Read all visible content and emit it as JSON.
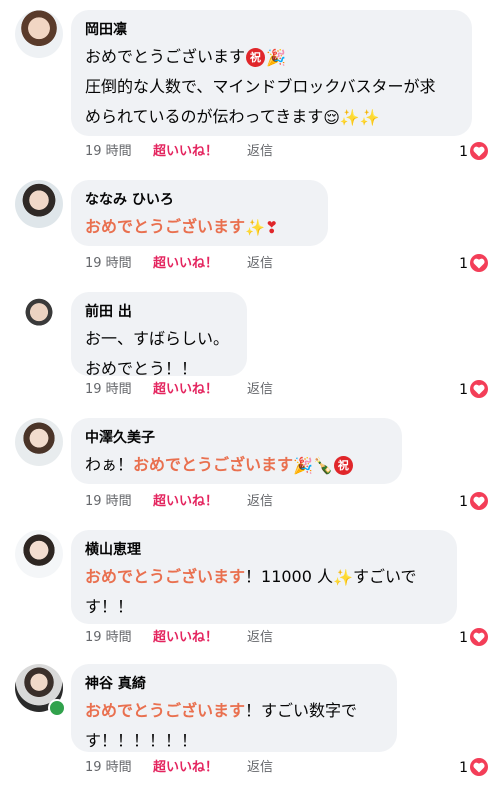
{
  "comments": [
    {
      "name": "岡田凛",
      "lines": [
        [
          {
            "t": "おめでとうございます"
          },
          {
            "badge": "祝"
          },
          {
            "e": "🎉"
          }
        ],
        [
          {
            "t": "圧倒的な人数で、マインドブロックバスターが求"
          }
        ],
        [
          {
            "t": "められているのが伝わってきます"
          },
          {
            "e": "😌✨✨"
          }
        ]
      ],
      "time": "19 時間",
      "like": "超いいね！",
      "reply": "返信",
      "reactions": "1"
    },
    {
      "name": "ななみ ひいろ",
      "lines": [
        [
          {
            "t": "おめでとうございます",
            "hl": true
          },
          {
            "e": "✨❣"
          }
        ]
      ],
      "time": "19 時間",
      "like": "超いいね！",
      "reply": "返信",
      "reactions": "1"
    },
    {
      "name": "前田 出",
      "lines": [
        [
          {
            "t": "お一、すばらしい。"
          }
        ],
        [
          {
            "t": "おめでとう！！"
          }
        ]
      ],
      "time": "19 時間",
      "like": "超いいね！",
      "reply": "返信",
      "reactions": "1"
    },
    {
      "name": "中澤久美子",
      "lines": [
        [
          {
            "t": "わぁ！"
          },
          {
            "t": "おめでとうございます",
            "hl": true
          },
          {
            "e": "🎉🍾"
          },
          {
            "badge": "祝"
          }
        ]
      ],
      "time": "19 時間",
      "like": "超いいね！",
      "reply": "返信",
      "reactions": "1"
    },
    {
      "name": "横山恵理",
      "lines": [
        [
          {
            "t": "おめでとうございます",
            "hl": true
          },
          {
            "t": "！11000 人"
          },
          {
            "e": "✨"
          },
          {
            "t": "すごいで"
          }
        ],
        [
          {
            "t": "す！！"
          }
        ]
      ],
      "time": "19 時間",
      "like": "超いいね！",
      "reply": "返信",
      "reactions": "1"
    },
    {
      "name": "神谷 真綺",
      "lines": [
        [
          {
            "t": "おめでとうございます",
            "hl": true
          },
          {
            "t": "！すごい数字で"
          }
        ],
        [
          {
            "t": "す！！！！！！"
          }
        ]
      ],
      "time": "19 時間",
      "like": "超いいね！",
      "reply": "返信",
      "reactions": "1",
      "online": true
    }
  ],
  "colors": {
    "highlight": "#e9704f",
    "like": "#e4255f",
    "heart": "#f33e58",
    "bubble": "#f0f2f5"
  }
}
